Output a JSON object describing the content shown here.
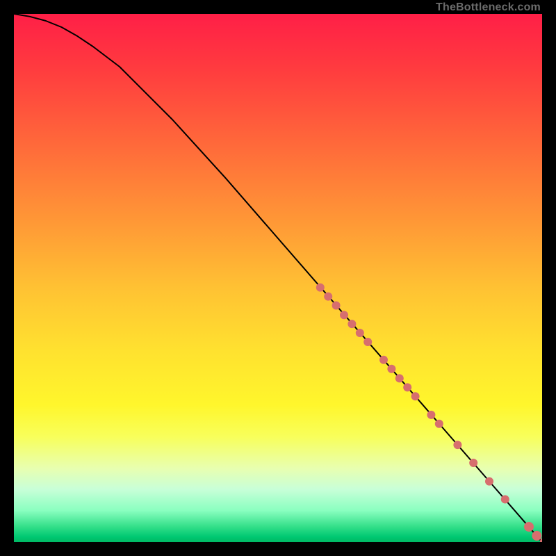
{
  "branding": "TheBottleneck.com",
  "chart_data": {
    "type": "line",
    "title": "",
    "xlabel": "",
    "ylabel": "",
    "xlim": [
      0,
      100
    ],
    "ylim": [
      0,
      100
    ],
    "grid": false,
    "legend": false,
    "series": [
      {
        "name": "curve",
        "x": [
          0,
          3,
          6,
          9,
          12,
          15,
          20,
          30,
          40,
          50,
          60,
          70,
          80,
          90,
          100
        ],
        "y": [
          100,
          99.5,
          98.7,
          97.5,
          95.8,
          93.8,
          90.0,
          80.0,
          69.0,
          57.5,
          46.0,
          34.5,
          23.0,
          11.5,
          0
        ]
      }
    ],
    "points": {
      "name": "highlighted-segment",
      "x": [
        58,
        59.5,
        61,
        62.5,
        64,
        65.5,
        67,
        70,
        71.5,
        73,
        74.5,
        76,
        79,
        80.5,
        84,
        87,
        90,
        93,
        97.5,
        99,
        100.5
      ],
      "y": [
        48.2,
        46.5,
        44.8,
        43.0,
        41.3,
        39.6,
        37.9,
        34.5,
        32.8,
        31.0,
        29.3,
        27.6,
        24.1,
        22.4,
        18.4,
        15.0,
        11.5,
        8.1,
        2.9,
        1.2,
        0
      ]
    }
  }
}
